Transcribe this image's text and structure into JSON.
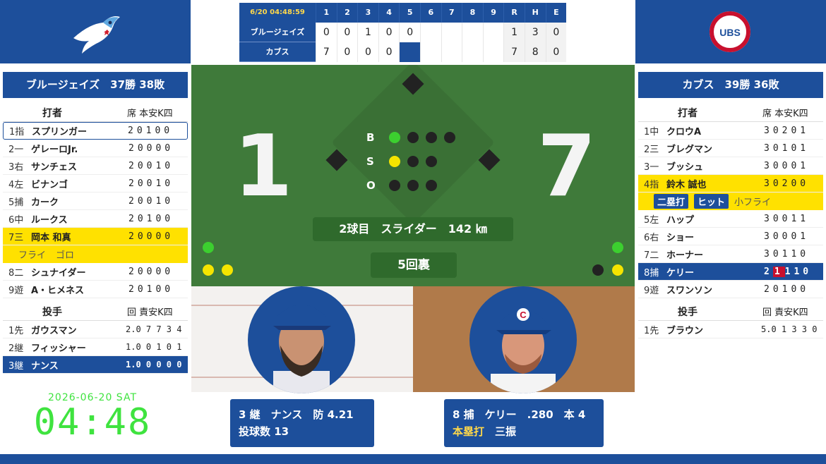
{
  "colors": {
    "navy": "#1d4f9b",
    "highlight": "#ffe100",
    "field": "#3f7a3a",
    "clock": "#3fe33f",
    "strike_red": "#c8102e"
  },
  "icons": {
    "left_logo": "blue-jays-logo",
    "right_logo": "cubs-logo"
  },
  "linescore": {
    "time": "6/20 04:48:59",
    "innings": [
      "1",
      "2",
      "3",
      "4",
      "5",
      "6",
      "7",
      "8",
      "9"
    ],
    "rhe_headers": [
      "R",
      "H",
      "E"
    ],
    "teams": [
      {
        "name": "ブルージェイズ",
        "innings": [
          "0",
          "0",
          "1",
          "0",
          "0",
          "",
          "",
          "",
          ""
        ],
        "rhe": [
          "1",
          "3",
          "0"
        ]
      },
      {
        "name": "カブス",
        "innings": [
          "7",
          "0",
          "0",
          "0",
          "",
          "",
          "",
          "",
          ""
        ],
        "rhe": [
          "7",
          "8",
          "0"
        ]
      }
    ]
  },
  "left_panel": {
    "team_title": "ブルージェイズ　37勝 38敗",
    "batter_header": "打者",
    "batter_cols": "席 本安K四",
    "batters": [
      {
        "pos": "1指",
        "name": "スプリンガー",
        "stats": "20100"
      },
      {
        "pos": "2一",
        "name": "ゲレーロJr.",
        "stats": "20000"
      },
      {
        "pos": "3右",
        "name": "サンチェス",
        "stats": "20010"
      },
      {
        "pos": "4左",
        "name": "ビナンゴ",
        "stats": "20010"
      },
      {
        "pos": "5捕",
        "name": "カーク",
        "stats": "20010"
      },
      {
        "pos": "6中",
        "name": "ルークス",
        "stats": "20100"
      },
      {
        "pos": "7三",
        "name": "岡本 和真",
        "stats": "20000"
      },
      {
        "pos": "8二",
        "name": "シュナイダー",
        "stats": "20000"
      },
      {
        "pos": "9遊",
        "name": "A・ヒメネス",
        "stats": "20100"
      }
    ],
    "okamoto_results": [
      "フライ",
      "ゴロ"
    ],
    "pitcher_header": "投手",
    "pitcher_cols": "回 責安K四",
    "pitchers": [
      {
        "pos": "1先",
        "name": "ガウスマン",
        "stats": "2.0 7 7 3 4"
      },
      {
        "pos": "2継",
        "name": "フィッシャー",
        "stats": "1.0 0 1 0 1"
      },
      {
        "pos": "3継",
        "name": "ナンス",
        "stats": "1.0 0 0 0 0"
      }
    ]
  },
  "right_panel": {
    "team_title": "カブス　39勝 36敗",
    "batter_header": "打者",
    "batter_cols": "席 本安K四",
    "batters": [
      {
        "pos": "1中",
        "name": "クロウA",
        "stats": "30201"
      },
      {
        "pos": "2三",
        "name": "ブレグマン",
        "stats": "30101"
      },
      {
        "pos": "3一",
        "name": "ブッシュ",
        "stats": "30001"
      },
      {
        "pos": "4指",
        "name": "鈴木 誠也",
        "stats": "30200"
      },
      {
        "pos": "5左",
        "name": "ハップ",
        "stats": "30011"
      },
      {
        "pos": "6右",
        "name": "ショー",
        "stats": "30001"
      },
      {
        "pos": "7二",
        "name": "ホーナー",
        "stats": "30110"
      },
      {
        "pos": "8捕",
        "name": "ケリー",
        "stats_pre": "2",
        "stats_red": "1",
        "stats_post": "110"
      },
      {
        "pos": "9遊",
        "name": "スワンソン",
        "stats": "20100"
      }
    ],
    "suzuki_results": [
      "二塁打",
      "ヒット",
      "小フライ"
    ],
    "pitcher_header": "投手",
    "pitcher_cols": "回 責安K四",
    "pitchers": [
      {
        "pos": "1先",
        "name": "ブラウン",
        "stats": "5.0 1 3 3 0"
      }
    ]
  },
  "field": {
    "away_score": "1",
    "home_score": "7",
    "bso_labels": [
      "B",
      "S",
      "O"
    ],
    "balls": 1,
    "strikes": 1,
    "outs": 0,
    "pitch_info": "2球目　スライダー　142 ㎞",
    "inning": "5回裏"
  },
  "pitcher_info": {
    "line1": "3 継　ナンス　防 4.21",
    "line2": "投球数 13"
  },
  "batter_info": {
    "line1": "8 捕　ケリー　.280　本 4",
    "result1": "本塁打",
    "result2": "三振"
  },
  "clock": {
    "date": "2026-06-20 SAT",
    "time": "04:48"
  }
}
